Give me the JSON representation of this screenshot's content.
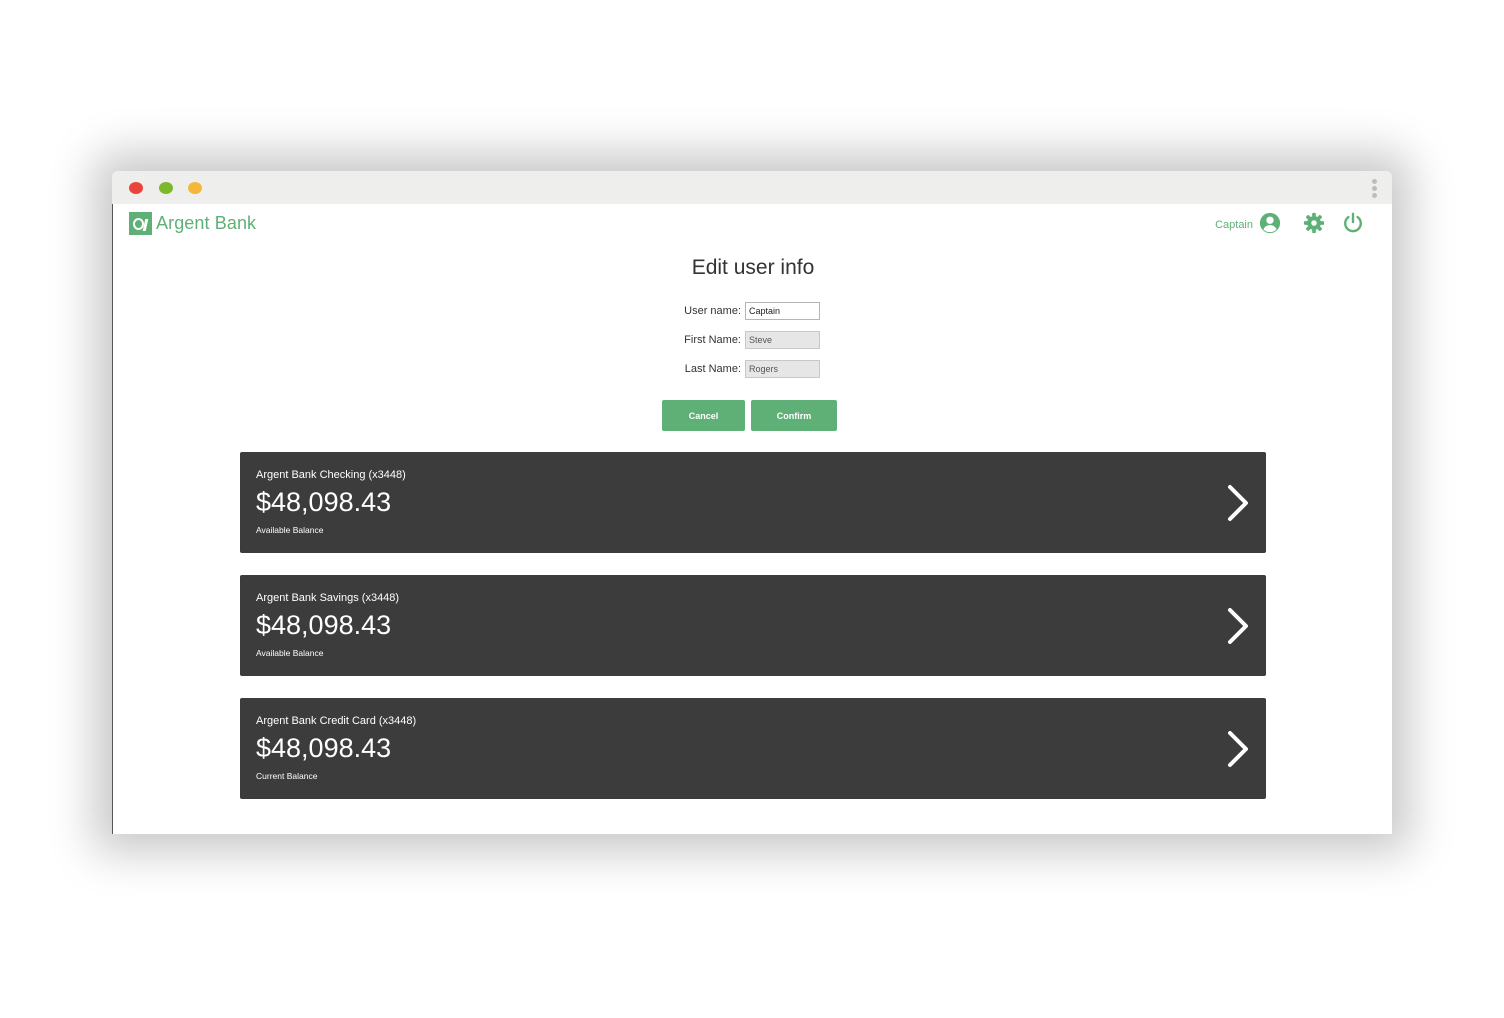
{
  "app": {
    "logo_text": "Argent Bank",
    "brand_color": "#5fb077"
  },
  "header": {
    "user_name": "Captain",
    "icons": [
      "user-circle-icon",
      "gear-icon",
      "power-icon"
    ]
  },
  "window": {
    "controls": [
      "close",
      "minimize",
      "maximize"
    ]
  },
  "page": {
    "title": "Edit user info"
  },
  "form": {
    "username_label": "User name:",
    "username_value": "Captain",
    "firstname_label": "First Name:",
    "firstname_value": "Steve",
    "lastname_label": "Last Name:",
    "lastname_value": "Rogers",
    "cancel_label": "Cancel",
    "confirm_label": "Confirm"
  },
  "accounts": [
    {
      "name": "Argent Bank Checking (x3448)",
      "balance": "$48,098.43",
      "balance_label": "Available Balance"
    },
    {
      "name": "Argent Bank Savings (x3448)",
      "balance": "$48,098.43",
      "balance_label": "Available Balance"
    },
    {
      "name": "Argent Bank Credit Card (x3448)",
      "balance": "$48,098.43",
      "balance_label": "Current Balance"
    }
  ]
}
